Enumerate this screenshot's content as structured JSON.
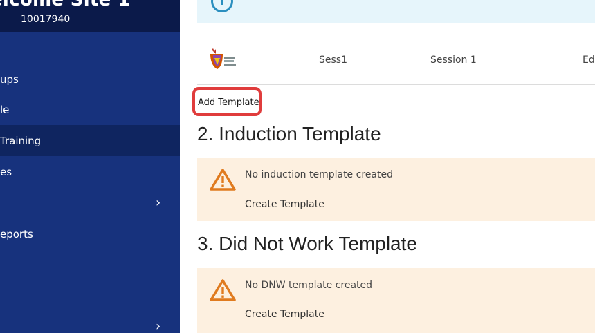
{
  "sidebar": {
    "site_title": "elcome Site 1",
    "site_id": "10017940",
    "items": [
      {
        "label": "ups",
        "has_chevron": false
      },
      {
        "label": "le",
        "has_chevron": false
      },
      {
        "label": "Training",
        "has_chevron": false,
        "active": true
      },
      {
        "label": "es",
        "has_chevron": false
      },
      {
        "label": "",
        "has_chevron": true,
        "chevron": "›"
      },
      {
        "label": "eports",
        "has_chevron": false
      },
      {
        "label": "",
        "has_chevron": true,
        "chevron": "›"
      }
    ]
  },
  "session": {
    "code": "Sess1",
    "name": "Session 1",
    "action": "Ed"
  },
  "add_template_label": "Add Template",
  "sections": [
    {
      "title": "2. Induction Template",
      "warning": "No induction template created",
      "action": "Create Template"
    },
    {
      "title": "3. Did Not Work Template",
      "warning": "No DNW template created",
      "action": "Create Template"
    }
  ],
  "colors": {
    "sidebar_bg": "#17327d",
    "sidebar_header_bg": "#0b1a4a",
    "warning_bg": "#fdf0e0",
    "warning_icon": "#e07b1f",
    "highlight": "#e03c3c",
    "info_bg": "#e6f5fb"
  }
}
